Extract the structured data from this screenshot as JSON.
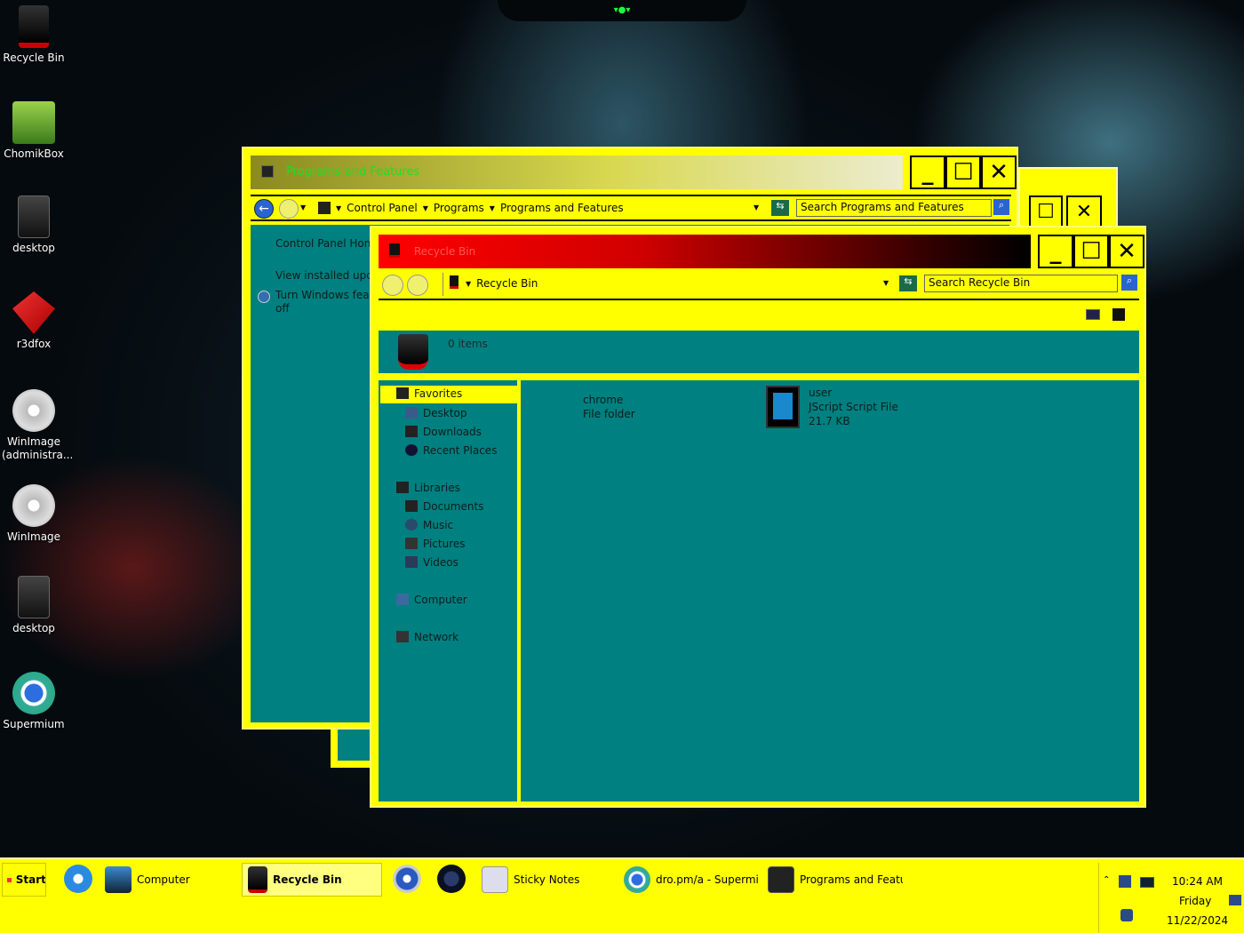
{
  "desktop": {
    "icons": [
      {
        "label": "Recycle Bin"
      },
      {
        "label": "ChomikBox"
      },
      {
        "label": "desktop"
      },
      {
        "label": "r3dfox"
      },
      {
        "label": "WinImage (administra..."
      },
      {
        "label": "WinImage"
      },
      {
        "label": "desktop"
      },
      {
        "label": "Supermium"
      }
    ]
  },
  "programs_window": {
    "title": "Programs and Features",
    "breadcrumb": [
      "Control Panel",
      "Programs",
      "Programs and Features"
    ],
    "search_placeholder": "Search Programs and Features",
    "side_links": [
      "Control Panel Home",
      "View installed updat",
      "Turn Windows featu",
      "off"
    ]
  },
  "recycle_window": {
    "title": "Recycle Bin",
    "breadcrumb": "Recycle Bin",
    "search_placeholder": "Search Recycle Bin",
    "item_count": "0 items",
    "nav": {
      "favorites": "Favorites",
      "favorites_items": [
        "Desktop",
        "Downloads",
        "Recent Places"
      ],
      "libraries": "Libraries",
      "libraries_items": [
        "Documents",
        "Music",
        "Pictures",
        "Videos"
      ],
      "computer": "Computer",
      "network": "Network"
    },
    "files": [
      {
        "name": "chrome",
        "type": "File folder",
        "size": ""
      },
      {
        "name": "user",
        "type": "JScript Script File",
        "size": "21.7 KB"
      }
    ]
  },
  "taskbar": {
    "start": "Start",
    "items": [
      {
        "label": "Computer"
      },
      {
        "label": "Recycle Bin"
      },
      {
        "label": "Sticky Notes"
      },
      {
        "label": "dro.pm/a - Supermi..."
      },
      {
        "label": "Programs and Featu..."
      }
    ],
    "clock": {
      "time": "10:24 AM",
      "day": "Friday",
      "date": "11/22/2024"
    }
  },
  "colors": {
    "window_frame": "#ffff00",
    "content": "#008080",
    "title_active": "#ff0000"
  }
}
